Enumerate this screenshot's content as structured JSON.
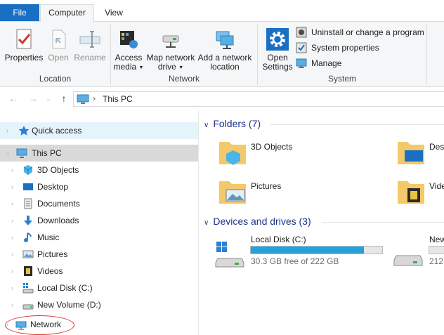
{
  "ribbon_tabs": {
    "file": "File",
    "computer": "Computer",
    "view": "View"
  },
  "ribbon": {
    "location": {
      "label": "Location",
      "properties": "Properties",
      "open": "Open",
      "rename": "Rename"
    },
    "network": {
      "label": "Network",
      "access_media_1": "Access",
      "access_media_2": "media",
      "map_drive_1": "Map network",
      "map_drive_2": "drive",
      "add_location_1": "Add a network",
      "add_location_2": "location"
    },
    "system": {
      "label": "System",
      "open_settings_1": "Open",
      "open_settings_2": "Settings",
      "uninstall": "Uninstall or change a program",
      "system_properties": "System properties",
      "manage": "Manage"
    }
  },
  "address": {
    "crumb": "This PC"
  },
  "nav_pane": {
    "quick_access": "Quick access",
    "this_pc": "This PC",
    "items": [
      "3D Objects",
      "Desktop",
      "Documents",
      "Downloads",
      "Music",
      "Pictures",
      "Videos",
      "Local Disk (C:)",
      "New Volume (D:)"
    ],
    "network": "Network"
  },
  "content": {
    "folders_header": "Folders (7)",
    "folders": [
      "3D Objects",
      "Desk",
      "Pictures",
      "Vide"
    ],
    "devices_header": "Devices and drives (3)",
    "drives": [
      {
        "name": "Local Disk (C:)",
        "free": "30.3 GB free of 222 GB",
        "used_fraction": 0.86
      },
      {
        "name": "New",
        "free": "212"
      }
    ]
  },
  "colors": {
    "file_tab": "#1a6fc4",
    "section_header": "#1e3287",
    "drive_bar": "#26a0da",
    "highlight_circle": "#d9342b"
  }
}
